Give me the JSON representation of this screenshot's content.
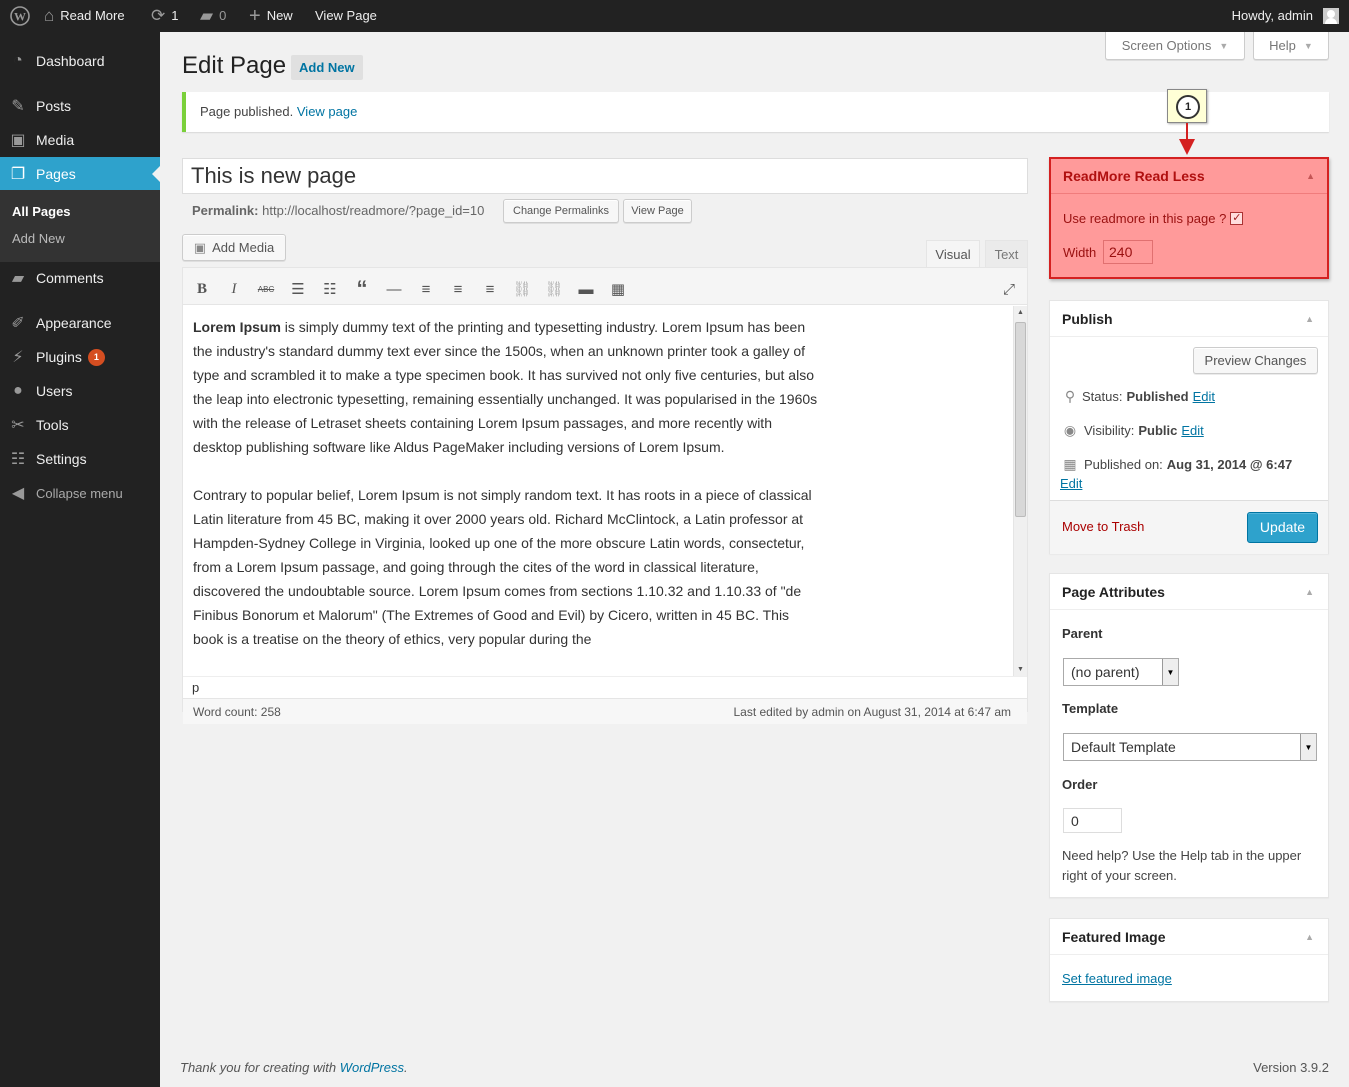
{
  "adminbar": {
    "site_name": "Read More",
    "updates": "1",
    "comments": "0",
    "new_label": "New",
    "view_page": "View Page",
    "howdy": "Howdy, admin"
  },
  "menu": {
    "dashboard": "Dashboard",
    "posts": "Posts",
    "media": "Media",
    "pages": "Pages",
    "all_pages": "All Pages",
    "add_new": "Add New",
    "comments": "Comments",
    "appearance": "Appearance",
    "plugins": "Plugins",
    "plugins_badge": "1",
    "users": "Users",
    "tools": "Tools",
    "settings": "Settings",
    "collapse": "Collapse menu"
  },
  "header": {
    "screen_options": "Screen Options",
    "help": "Help",
    "title": "Edit Page",
    "add_new": "Add New"
  },
  "notice": {
    "text": "Page published.",
    "link": "View page"
  },
  "editor": {
    "post_title": "This is new page",
    "permalink_label": "Permalink:",
    "permalink_url": "http://localhost/readmore/?page_id=10",
    "change_permalinks": "Change Permalinks",
    "view_page": "View Page",
    "add_media": "Add Media",
    "tab_visual": "Visual",
    "tab_text": "Text",
    "p1_bold": "Lorem Ipsum",
    "p1_rest": " is simply dummy text of the printing and typesetting industry. Lorem Ipsum has been the industry's standard dummy text ever since the 1500s, when an unknown printer took a galley of type and scrambled it to make a type specimen book. It has survived not only five centuries, but also the leap into electronic typesetting, remaining essentially unchanged. It was popularised in the 1960s with the release of Letraset sheets containing Lorem Ipsum passages, and more recently with desktop publishing software like Aldus PageMaker including versions of Lorem Ipsum.",
    "p2": "Contrary to popular belief, Lorem Ipsum is not simply random text. It has roots in a piece of classical Latin literature from 45 BC, making it over 2000 years old. Richard McClintock, a Latin professor at Hampden-Sydney College in Virginia, looked up one of the more obscure Latin words, consectetur, from a Lorem Ipsum passage, and going through the cites of the word in classical literature, discovered the undoubtable source. Lorem Ipsum comes from sections 1.10.32 and 1.10.33 of \"de Finibus Bonorum et Malorum\" (The Extremes of Good and Evil) by Cicero, written in 45 BC. This book is a treatise on the theory of ethics, very popular during the",
    "path": "p",
    "word_count": "Word count: 258",
    "last_edited": "Last edited by admin on August 31, 2014 at 6:47 am"
  },
  "readmore_box": {
    "callout_number": "1",
    "title": "ReadMore Read Less",
    "use_label": "Use readmore in this page ?",
    "checked": true,
    "width_label": "Width",
    "width_value": "240",
    "highlight_color": "#ff9a9a",
    "highlight_border": "#d42121"
  },
  "publish": {
    "title": "Publish",
    "preview": "Preview Changes",
    "status_label": "Status:",
    "status_value": "Published",
    "visibility_label": "Visibility:",
    "visibility_value": "Public",
    "published_on_label": "Published on:",
    "published_on_value": "Aug 31, 2014 @ 6:47",
    "edit": "Edit",
    "trash": "Move to Trash",
    "update": "Update"
  },
  "attributes": {
    "title": "Page Attributes",
    "parent_label": "Parent",
    "parent_value": "(no parent)",
    "template_label": "Template",
    "template_value": "Default Template",
    "order_label": "Order",
    "order_value": "0",
    "help": "Need help? Use the Help tab in the upper right of your screen."
  },
  "featured": {
    "title": "Featured Image",
    "link": "Set featured image"
  },
  "footer": {
    "thanks": "Thank you for creating with ",
    "wp": "WordPress",
    "period": ".",
    "version": "Version 3.9.2"
  }
}
